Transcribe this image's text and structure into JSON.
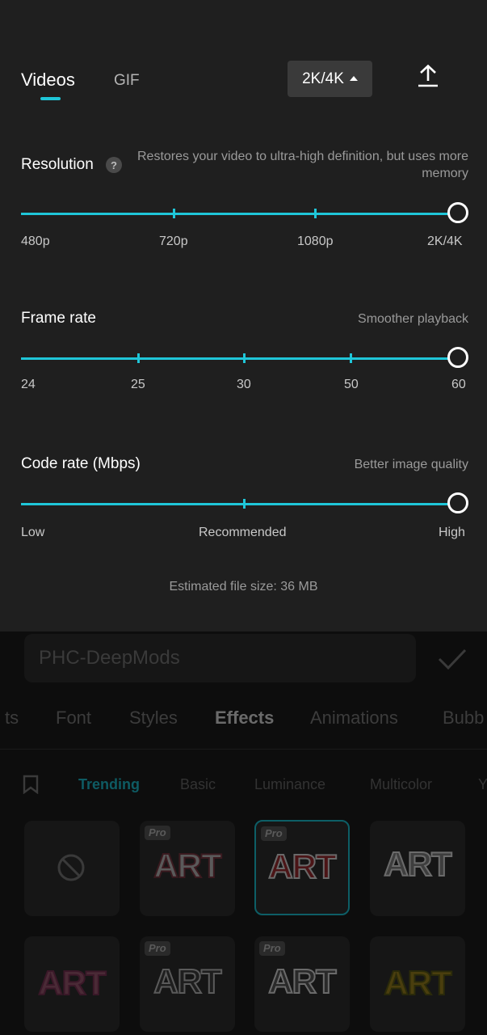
{
  "export": {
    "tabs": [
      {
        "label": "Videos",
        "active": true
      },
      {
        "label": "GIF",
        "active": false
      }
    ],
    "resolution_dropdown": "2K/4K",
    "resolution": {
      "title": "Resolution",
      "help": "?",
      "description": "Restores your video to ultra-high definition, but uses more memory",
      "options": [
        "480p",
        "720p",
        "1080p",
        "2K/4K"
      ],
      "selected": "2K/4K"
    },
    "frame_rate": {
      "title": "Frame rate",
      "description": "Smoother playback",
      "options": [
        "24",
        "25",
        "30",
        "50",
        "60"
      ],
      "selected": "60"
    },
    "code_rate": {
      "title": "Code rate (Mbps)",
      "description": "Better image quality",
      "options": [
        "Low",
        "Recommended",
        "High"
      ],
      "selected": "High"
    },
    "estimated_size": "Estimated file size: 36 MB"
  },
  "editor": {
    "text_value": "PHC-DeepMods",
    "style_tabs": [
      "ts",
      "Font",
      "Styles",
      "Effects",
      "Animations",
      "Bubb"
    ],
    "active_style_tab": "Effects",
    "categories": [
      "Trending",
      "Basic",
      "Luminance",
      "Multicolor",
      "Y"
    ],
    "active_category": "Trending",
    "tiles": [
      {
        "label": "",
        "pro": false,
        "none": true
      },
      {
        "label": "ART",
        "pro": true,
        "pro_label": "Pro",
        "color": "#5a5a5a",
        "outline": "#3a1a1f"
      },
      {
        "label": "ART",
        "pro": true,
        "pro_label": "Pro",
        "color": "#4b1416",
        "outline": "#6a6a6a",
        "selected": true
      },
      {
        "label": "ART",
        "pro": false,
        "color": "#3e3e3e",
        "outline": "#6b6b6b"
      },
      {
        "label": "ART",
        "pro": false,
        "color": "#4a2a36",
        "outline": "#3a1828"
      },
      {
        "label": "ART",
        "pro": true,
        "pro_label": "Pro",
        "color": "#1e1e1e",
        "outline": "#5a5a5a"
      },
      {
        "label": "ART",
        "pro": true,
        "pro_label": "Pro",
        "color": "#2a2a2a",
        "outline": "#6a6a6a"
      },
      {
        "label": "ART",
        "pro": false,
        "color": "#4a3e0e",
        "outline": "#2a2a0a"
      }
    ]
  },
  "colors": {
    "accent": "#1fc6d8",
    "panel": "#1f1f1f"
  }
}
